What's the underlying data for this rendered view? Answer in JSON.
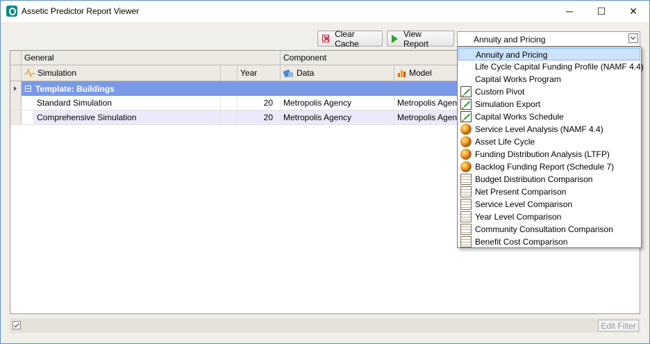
{
  "window": {
    "title": "Assetic Predictor Report Viewer",
    "minimize": "─",
    "maximize": "☐",
    "close": "✕"
  },
  "toolbar": {
    "clear_cache": "Clear Cache",
    "view_report": "View Report",
    "report_selected": "Annuity and Pricing"
  },
  "grid": {
    "group_headers": [
      "General",
      "Component"
    ],
    "columns": [
      "Simulation",
      "Year",
      "Data",
      "Model"
    ],
    "group_row": "Template: Buildings",
    "rows": [
      {
        "simulation": "Standard Simulation",
        "year": "20",
        "data": "Metropolis Agency",
        "model": "Metropolis Agency"
      },
      {
        "simulation": "Comprehensive Simulation",
        "year": "20",
        "data": "Metropolis Agency",
        "model": "Metropolis Agency"
      }
    ]
  },
  "footer": {
    "edit_filter": "Edit Filter"
  },
  "dropdown": {
    "items": [
      {
        "label": "Annuity and Pricing",
        "icon": "none"
      },
      {
        "label": "Life Cycle Capital Funding Profile (NAMF 4.4)",
        "icon": "none"
      },
      {
        "label": "Capital Works Program",
        "icon": "none"
      },
      {
        "label": "Custom Pivot",
        "icon": "pivot-icon"
      },
      {
        "label": "Simulation Export",
        "icon": "pivot-icon"
      },
      {
        "label": "Capital Works Schedule",
        "icon": "pivot-icon"
      },
      {
        "label": "Service Level Analysis (NAMF 4.4)",
        "icon": "chart-ball-icon"
      },
      {
        "label": "Asset Life Cycle",
        "icon": "chart-ball-icon"
      },
      {
        "label": "Funding Distribution Analysis (LTFP)",
        "icon": "chart-ball-icon"
      },
      {
        "label": "Backlog Funding Report (Schedule 7)",
        "icon": "chart-ball-icon"
      },
      {
        "label": "Budget Distribution Comparison",
        "icon": "document-icon"
      },
      {
        "label": "Net Present Comparison",
        "icon": "document-icon"
      },
      {
        "label": "Service Level Comparison",
        "icon": "document-icon"
      },
      {
        "label": "Year Level Comparison",
        "icon": "document-icon"
      },
      {
        "label": "Community Consultation Comparison",
        "icon": "document-icon"
      },
      {
        "label": "Benefit Cost Comparison",
        "icon": "document-icon"
      }
    ]
  }
}
